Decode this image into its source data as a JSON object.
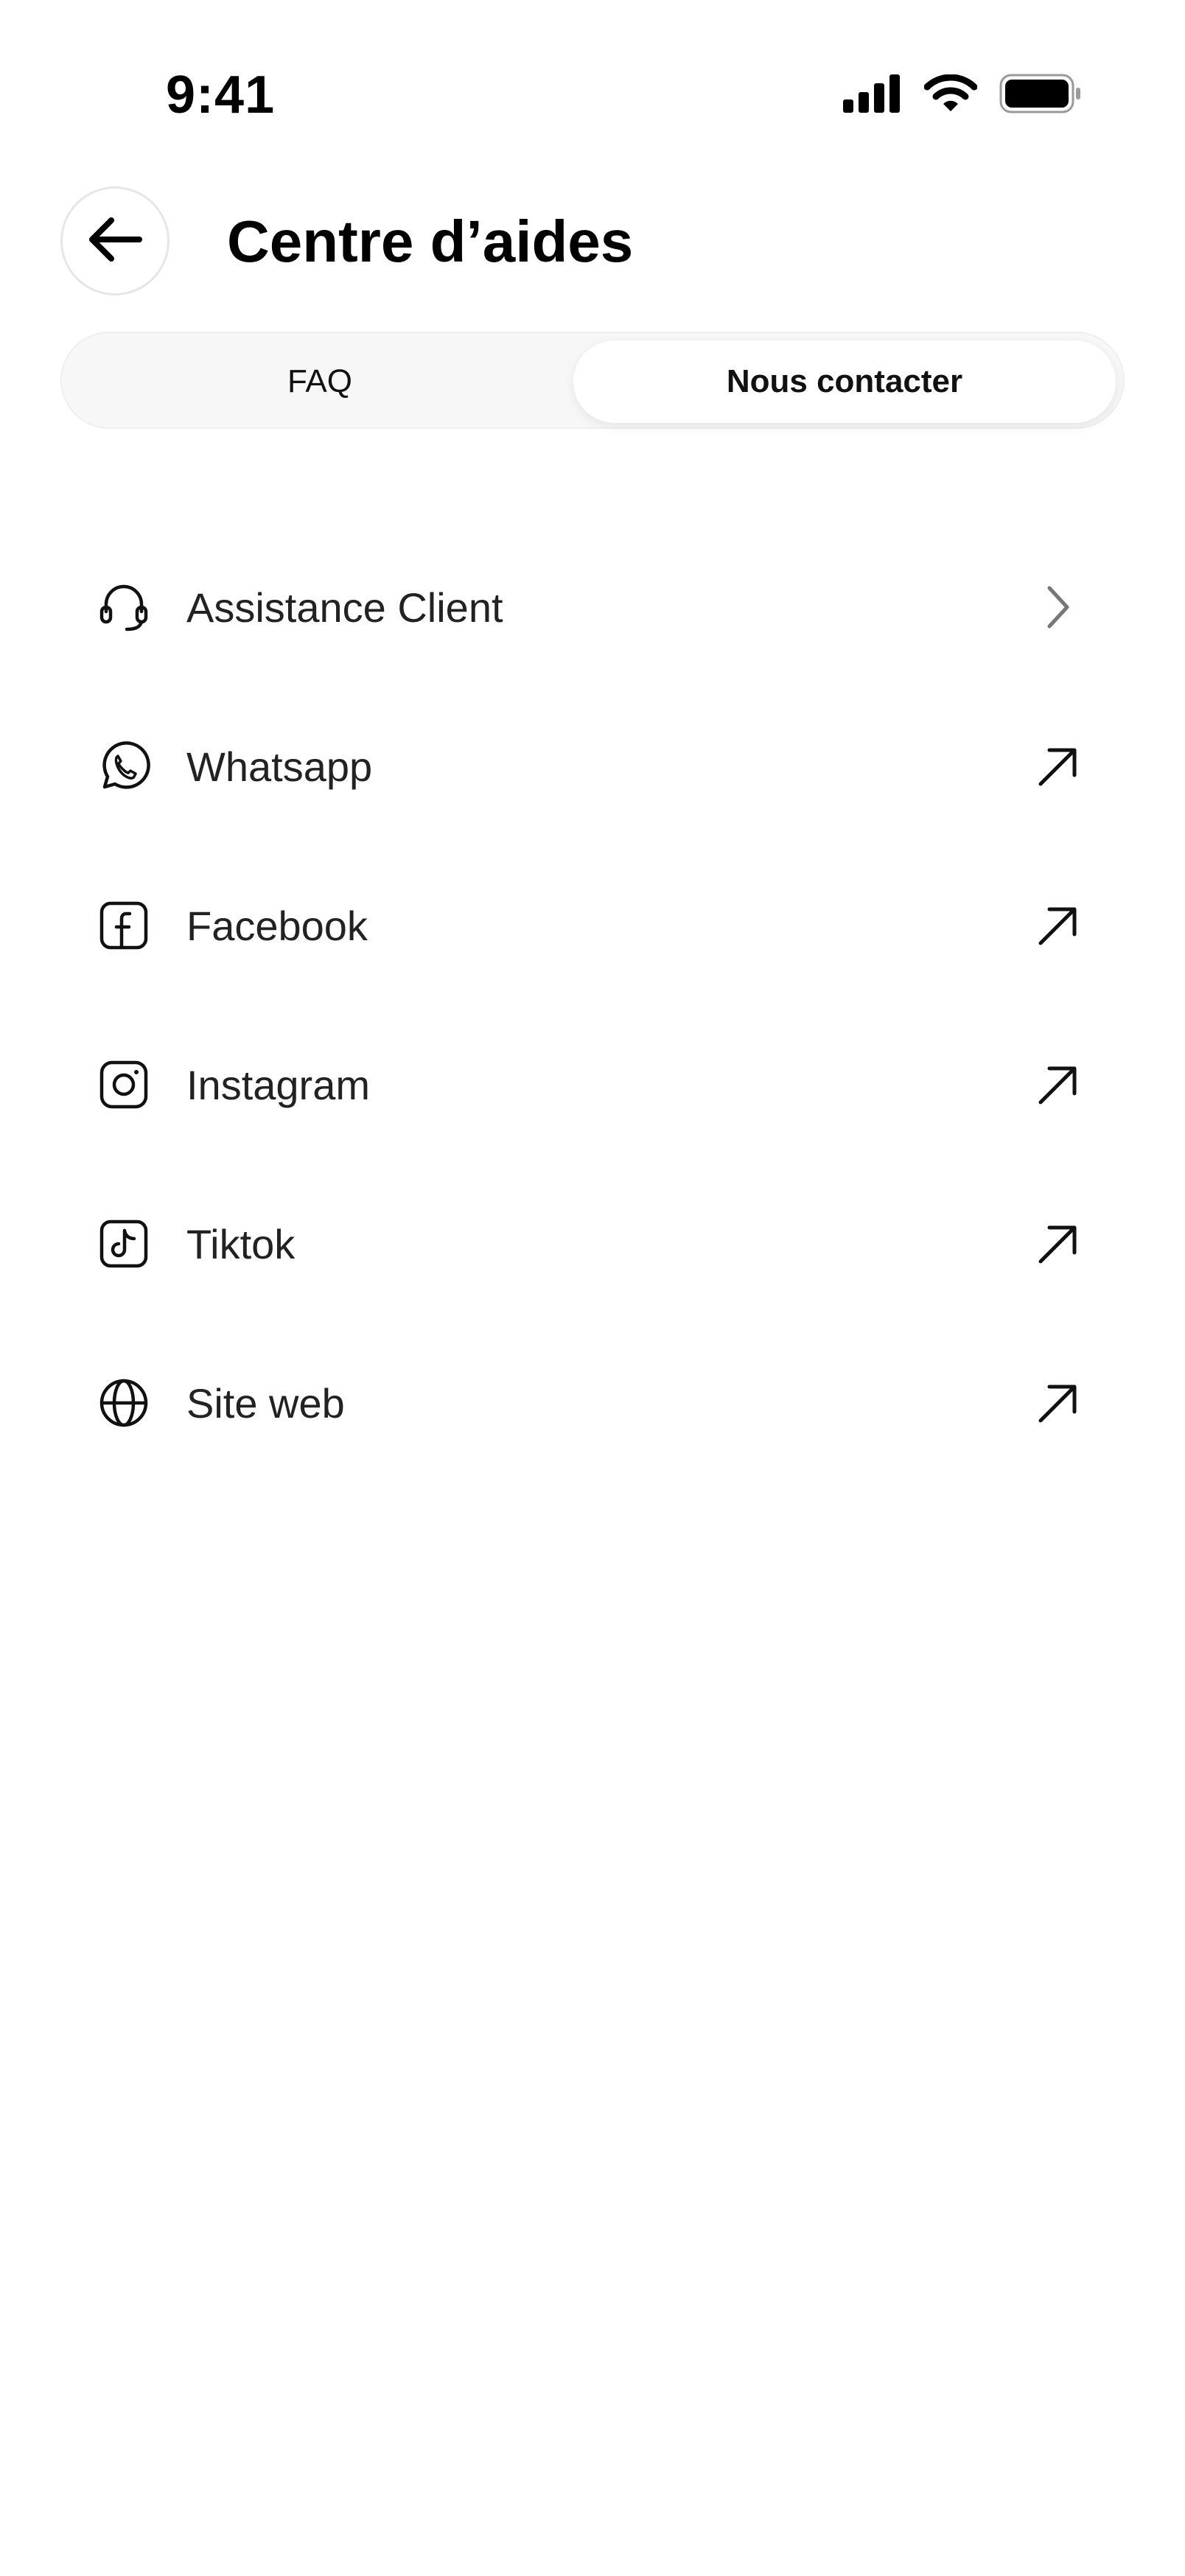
{
  "status_bar": {
    "time": "9:41",
    "icons": [
      "cellular-signal-icon",
      "wifi-icon",
      "battery-icon"
    ]
  },
  "header": {
    "back_icon": "arrow-left-icon",
    "title": "Centre d’aides"
  },
  "tabs": [
    {
      "label": "FAQ",
      "selected": false
    },
    {
      "label": "Nous contacter",
      "selected": true
    }
  ],
  "contact_items": [
    {
      "label": "Assistance Client",
      "icon": "headset-icon",
      "trailing": "chevron-right-icon"
    },
    {
      "label": "Whatsapp",
      "icon": "whatsapp-icon",
      "trailing": "arrow-up-right-icon"
    },
    {
      "label": "Facebook",
      "icon": "facebook-icon",
      "trailing": "arrow-up-right-icon"
    },
    {
      "label": "Instagram",
      "icon": "instagram-icon",
      "trailing": "arrow-up-right-icon"
    },
    {
      "label": "Tiktok",
      "icon": "tiktok-icon",
      "trailing": "arrow-up-right-icon"
    },
    {
      "label": "Site web",
      "icon": "globe-icon",
      "trailing": "arrow-up-right-icon"
    }
  ],
  "colors": {
    "background": "#ffffff",
    "text": "#222222",
    "tab_track": "#f7f7f7",
    "chevron": "#777777"
  }
}
